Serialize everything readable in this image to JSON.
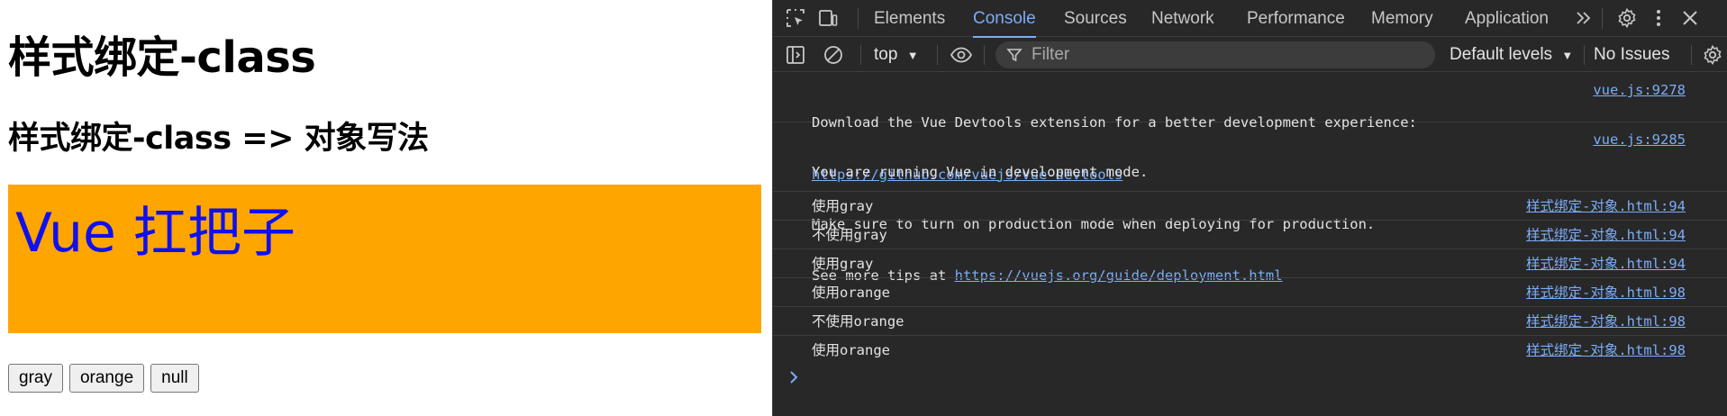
{
  "page": {
    "title": "样式绑定-class",
    "subtitle": "样式绑定-class => 对象写法",
    "demo_text": "Vue 扛把子",
    "demo_bg": "#ffa500",
    "demo_color": "#1010ee",
    "buttons": [
      "gray",
      "orange",
      "null"
    ]
  },
  "devtools": {
    "icons": [
      "inspect-element-icon",
      "device-toolbar-icon",
      "more-tabs-icon",
      "settings-icon",
      "more-options-icon",
      "close-icon",
      "sidebar-toggle-icon",
      "clear-console-icon",
      "eye-icon",
      "filter-icon",
      "console-settings-icon"
    ],
    "tabs": [
      "Elements",
      "Console",
      "Sources",
      "Network",
      "Performance",
      "Memory",
      "Application"
    ],
    "active_tab": "Console",
    "context": "top",
    "filter_placeholder": "Filter",
    "levels": "Default levels",
    "issues": "No Issues",
    "accent": "#7cacf8",
    "messages": [
      {
        "lines": [
          "Download the Vue Devtools extension for a better development experience:"
        ],
        "link": "https://github.com/vuejs/vue-devtools",
        "source": "vue.js:9278"
      },
      {
        "lines": [
          "You are running Vue in development mode.",
          "Make sure to turn on production mode when deploying for production."
        ],
        "prefix": "See more tips at ",
        "link": "https://vuejs.org/guide/deployment.html",
        "source": "vue.js:9285"
      },
      {
        "text": "使用gray",
        "source": "样式绑定-对象.html:94"
      },
      {
        "text": "不使用gray",
        "source": "样式绑定-对象.html:94"
      },
      {
        "text": "使用gray",
        "source": "样式绑定-对象.html:94"
      },
      {
        "text": "使用orange",
        "source": "样式绑定-对象.html:98"
      },
      {
        "text": "不使用orange",
        "source": "样式绑定-对象.html:98"
      },
      {
        "text": "使用orange",
        "source": "样式绑定-对象.html:98"
      }
    ]
  }
}
